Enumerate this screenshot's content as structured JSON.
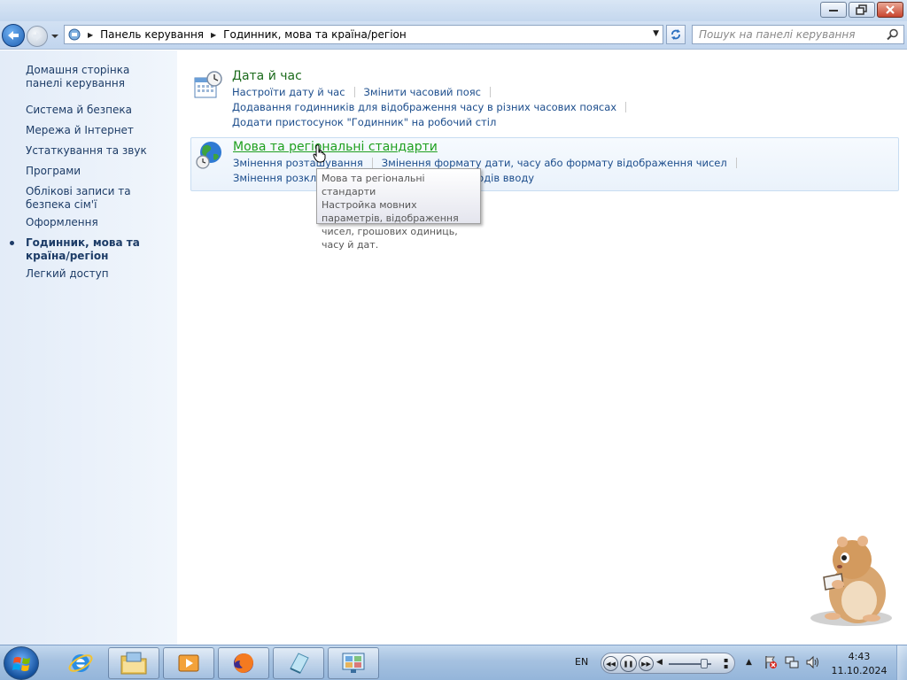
{
  "window": {
    "buttons": [
      "minimize",
      "restore",
      "close"
    ]
  },
  "navigation": {
    "breadcrumbs": [
      "Панель керування",
      "Годинник, мова та країна/регіон"
    ],
    "search_placeholder": "Пошук на панелі керування"
  },
  "sidebar": {
    "items": [
      {
        "label": "Домашня сторінка панелі керування",
        "current": false
      },
      {
        "label": "Система й безпека",
        "current": false
      },
      {
        "label": "Мережа й Інтернет",
        "current": false
      },
      {
        "label": "Устаткування та звук",
        "current": false
      },
      {
        "label": "Програми",
        "current": false
      },
      {
        "label": "Облікові записи та безпека сім'ї",
        "current": false
      },
      {
        "label": "Оформлення",
        "current": false
      },
      {
        "label": "Годинник, мова та країна/регіон",
        "current": true
      },
      {
        "label": "Легкий доступ",
        "current": false
      }
    ]
  },
  "categories": [
    {
      "title": "Дата й час",
      "icon": "calendar-clock-icon",
      "links": [
        [
          "Настроїти дату й час",
          "Змінити часовий пояс"
        ],
        [
          "Додавання годинників для відображення часу в різних часових поясах"
        ],
        [
          "Додати пристосунок \"Годинник\" на робочий стіл"
        ]
      ]
    },
    {
      "title": "Мова та регіональні стандарти",
      "icon": "globe-clock-icon",
      "hovered": true,
      "links": [
        [
          "Змінення розташування",
          "Змінення формату дати, часу або формату відображення чисел"
        ],
        [
          "Змінення розкладок клавіатури та інших методів вводу"
        ]
      ]
    }
  ],
  "tooltip": {
    "title": "Мова та регіональні стандарти",
    "text": "Настройка мовних параметрів, відображення чисел, грошових одиниць, часу й дат."
  },
  "taskbar": {
    "pinned": [
      "explorer-icon",
      "media-player-icon",
      "firefox-icon",
      "notepad-icon",
      "control-panel-icon"
    ],
    "language": "EN",
    "clock_time": "4:43",
    "clock_date": "11.10.2024"
  },
  "colors": {
    "sidebar_link": "#1d3c67",
    "category_title": "#1c6b1c",
    "category_hover": "#1fa01f",
    "task_link": "#1c4d8c"
  }
}
